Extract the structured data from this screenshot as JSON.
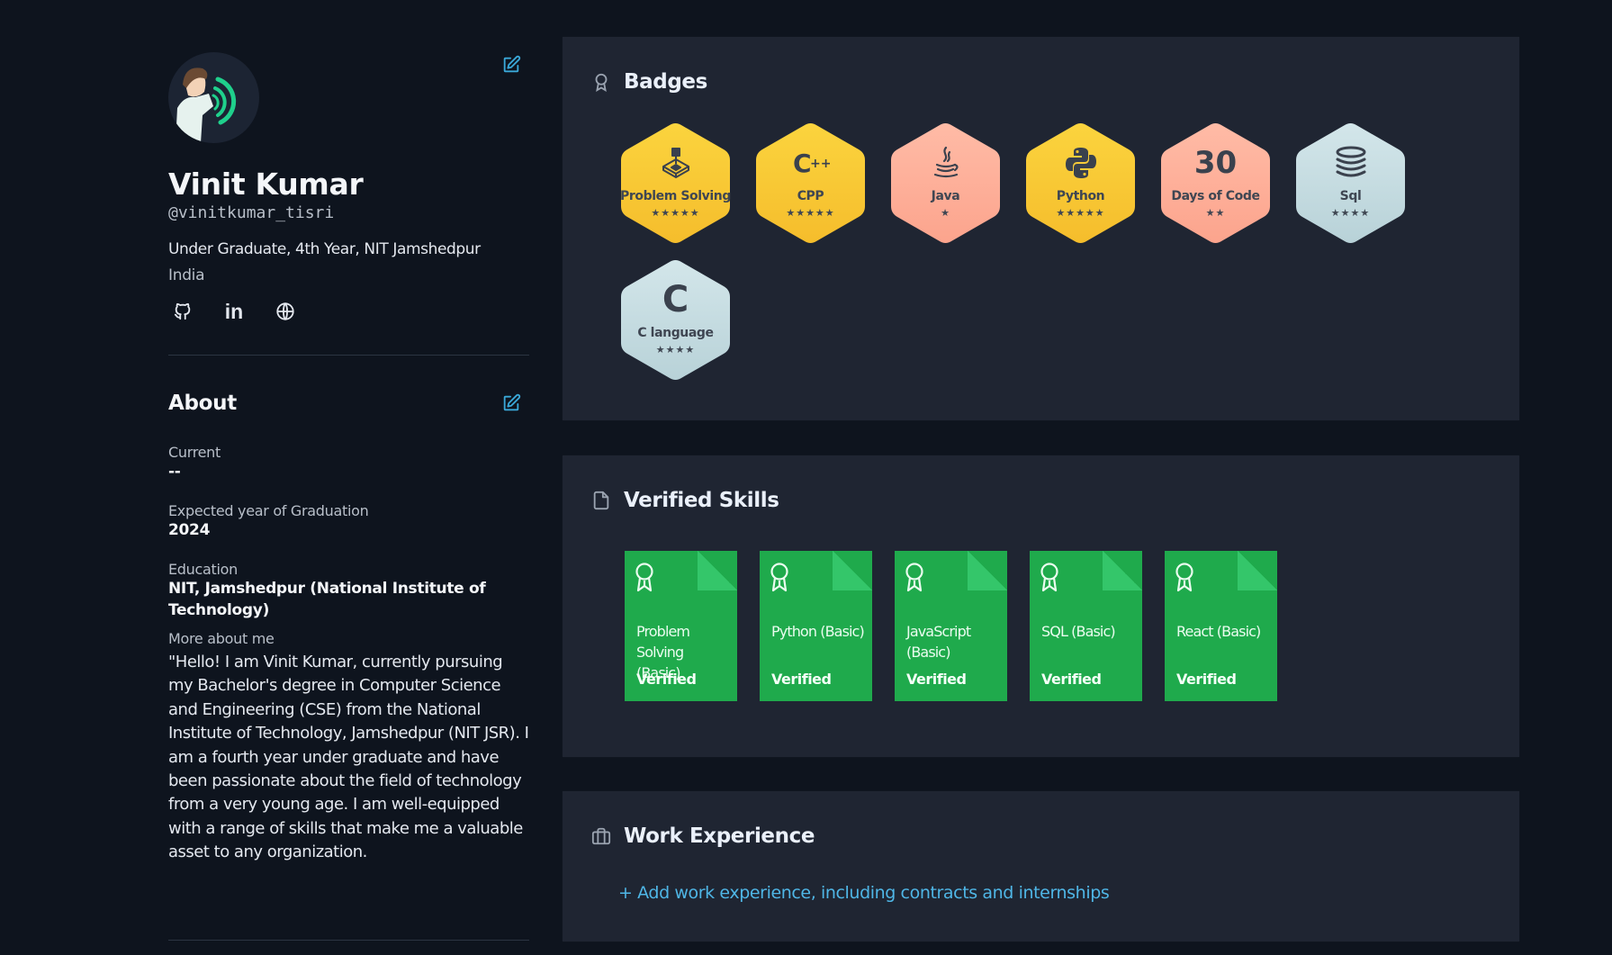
{
  "profile": {
    "name": "Vinit Kumar",
    "handle": "@vinitkumar_tisri",
    "headline": "Under Graduate, 4th Year, NIT Jamshedpur",
    "location": "India",
    "socials": [
      {
        "name": "github",
        "icon": "github-icon"
      },
      {
        "name": "linkedin",
        "icon": "linkedin-icon",
        "glyph": "in"
      },
      {
        "name": "website",
        "icon": "globe-icon"
      }
    ]
  },
  "about": {
    "title": "About",
    "fields": [
      {
        "label": "Current",
        "value": "--"
      },
      {
        "label": "Expected year of Graduation",
        "value": "2024"
      },
      {
        "label": "Education",
        "value": "NIT, Jamshedpur (National Institute of Technology)"
      }
    ],
    "more_label": "More about me",
    "bio": "\"Hello! I am Vinit Kumar, currently pursuing my Bachelor's degree in Computer Science and Engineering (CSE) from the National Institute of Technology, Jamshedpur (NIT JSR). I am a fourth year under graduate and have been passionate about the field of technology from a very young age. I am well-equipped with a range of skills that make me a valuable asset to any organization."
  },
  "badges": {
    "title": "Badges",
    "items": [
      {
        "label": "Problem Solving",
        "stars": 5,
        "star_text": "★★★★★",
        "tier": "gold",
        "icon": "problem-solving-icon"
      },
      {
        "label": "CPP",
        "stars": 5,
        "star_text": "★★★★★",
        "tier": "gold",
        "icon": "cpp-icon"
      },
      {
        "label": "Java",
        "stars": 1,
        "star_text": "★",
        "tier": "bronze",
        "icon": "java-icon"
      },
      {
        "label": "Python",
        "stars": 5,
        "star_text": "★★★★★",
        "tier": "gold",
        "icon": "python-icon"
      },
      {
        "label": "Days of Code",
        "stars": 2,
        "star_text": "★★",
        "tier": "bronze",
        "icon": "thirty-icon",
        "big_text": "30"
      },
      {
        "label": "Sql",
        "stars": 4,
        "star_text": "★★★★",
        "tier": "silver",
        "icon": "database-icon"
      },
      {
        "label": "C language",
        "stars": 4,
        "star_text": "★★★★",
        "tier": "silver",
        "icon": "c-icon",
        "big_text": "C"
      }
    ]
  },
  "verified_skills": {
    "title": "Verified Skills",
    "items": [
      {
        "name": "Problem Solving (Basic)",
        "status": "Verified"
      },
      {
        "name": "Python (Basic)",
        "status": "Verified"
      },
      {
        "name": "JavaScript (Basic)",
        "status": "Verified"
      },
      {
        "name": "SQL (Basic)",
        "status": "Verified"
      },
      {
        "name": "React (Basic)",
        "status": "Verified"
      }
    ]
  },
  "work_experience": {
    "title": "Work Experience",
    "add_link": "+ Add work experience, including contracts and internships"
  },
  "colors": {
    "background": "#0e141e",
    "panel": "#1f2532",
    "accent_link": "#4fb6e6",
    "verified_green": "#1faa4c",
    "gold": "#f8c732",
    "bronze": "#ffb3a0",
    "silver": "#c6dde2"
  }
}
